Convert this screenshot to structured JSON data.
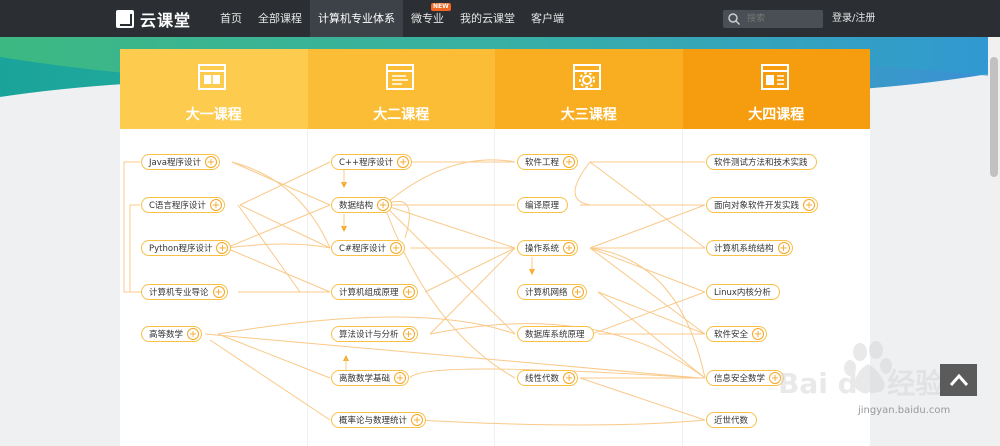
{
  "header": {
    "logo_text": "云课堂",
    "nav": [
      {
        "label": "首页"
      },
      {
        "label": "全部课程"
      },
      {
        "label": "计算机专业体系",
        "active": true
      },
      {
        "label": "微专业",
        "badge": "NEW"
      },
      {
        "label": "我的云课堂"
      },
      {
        "label": "客户端"
      }
    ],
    "search_placeholder": "搜索",
    "login_label": "登录/注册"
  },
  "columns": [
    {
      "title": "大一课程",
      "color": "#fdcb4d",
      "icon": "book-icon"
    },
    {
      "title": "大二课程",
      "color": "#fbbd35",
      "icon": "document-icon"
    },
    {
      "title": "大三课程",
      "color": "#f9ae22",
      "icon": "settings-window-icon"
    },
    {
      "title": "大四课程",
      "color": "#f59d0e",
      "icon": "layout-window-icon"
    }
  ],
  "courses": {
    "year1": [
      {
        "name": "Java程序设计",
        "plus": true
      },
      {
        "name": "C语言程序设计",
        "plus": true
      },
      {
        "name": "Python程序设计",
        "plus": true
      },
      {
        "name": "计算机专业导论",
        "plus": true
      },
      {
        "name": "高等数学",
        "plus": true
      }
    ],
    "year2": [
      {
        "name": "C++程序设计",
        "plus": true
      },
      {
        "name": "数据结构",
        "plus": true
      },
      {
        "name": "C#程序设计",
        "plus": true
      },
      {
        "name": "计算机组成原理",
        "plus": true
      },
      {
        "name": "算法设计与分析",
        "plus": true
      },
      {
        "name": "离散数学基础",
        "plus": true
      },
      {
        "name": "概率论与数理统计",
        "plus": true
      }
    ],
    "year3": [
      {
        "name": "软件工程",
        "plus": true
      },
      {
        "name": "编译原理",
        "plus": false
      },
      {
        "name": "操作系统",
        "plus": true
      },
      {
        "name": "计算机网络",
        "plus": true
      },
      {
        "name": "数据库系统原理",
        "plus": false
      },
      {
        "name": "线性代数",
        "plus": true
      }
    ],
    "year4": [
      {
        "name": "软件测试方法和技术实践",
        "plus": false
      },
      {
        "name": "面向对象软件开发实践",
        "plus": true
      },
      {
        "name": "计算机系统结构",
        "plus": true
      },
      {
        "name": "Linux内核分析",
        "plus": false
      },
      {
        "name": "软件安全",
        "plus": true
      },
      {
        "name": "信息安全数学",
        "plus": true
      },
      {
        "name": "近世代数",
        "plus": false
      }
    ]
  },
  "watermark": {
    "text": "jingyan.baidu.com",
    "logo": "Bai du 经验"
  },
  "colors": {
    "nav_bg": "#2b2f33",
    "accent": "#f5a623",
    "link_line": "#f8c98a"
  }
}
